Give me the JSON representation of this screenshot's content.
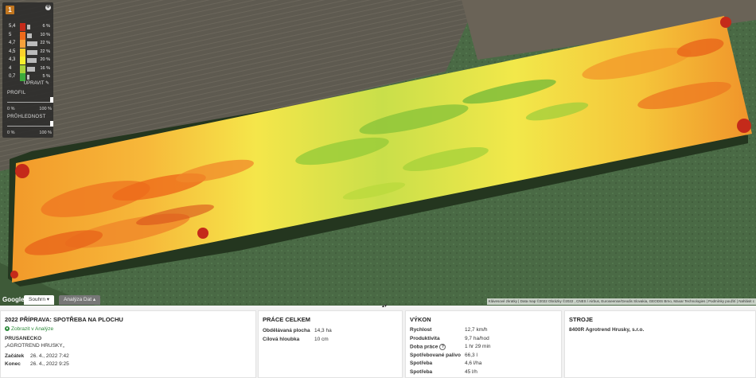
{
  "legend": {
    "badge": "1",
    "rows": [
      {
        "value": "5,4",
        "color": "#c42a1a",
        "pct": "6 %",
        "share": 0.06
      },
      {
        "value": "5",
        "color": "#ee6a1a",
        "pct": "10 %",
        "share": 0.1
      },
      {
        "value": "4,7",
        "color": "#f6a13a",
        "pct": "22 %",
        "share": 0.22
      },
      {
        "value": "4,5",
        "color": "#fbd22a",
        "pct": "22 %",
        "share": 0.22
      },
      {
        "value": "4,3",
        "color": "#f7ef2b",
        "pct": "20 %",
        "share": 0.2
      },
      {
        "value": "4",
        "color": "#a8d23a",
        "pct": "16 %",
        "share": 0.16
      },
      {
        "value": "0,7",
        "color": "#3caa3c",
        "pct": "5 %",
        "share": 0.05
      }
    ],
    "edit_label": "UPRAVIT",
    "profile_label": "PROFIL",
    "transparency_label": "PRŮHLEDNOST",
    "range_min": "0 %",
    "range_max": "100 %"
  },
  "map": {
    "google_label": "Google",
    "tab_summary": "Souhrn",
    "tab_analysis": "Analýza Dat",
    "attribution": "Klávesové zkratky | Data map ©2022 Obrázky ©2022 , CNES / Airbus, Euroseense/Geodis Slovakia, GEODIS Brno, Maxar Technologies | Podmínky použití | Nahlásit c"
  },
  "task": {
    "title": "2022 PŘÍPRAVA: SPOTŘEBA NA PLOCHU",
    "analysis_link": "Zobrazit v Analýze",
    "field_name": "PRUSANECKO",
    "company": "„AGROTREND HRUSKY„",
    "start_label": "Začátek",
    "start_value": "26. 4., 2022 7:42",
    "end_label": "Konec",
    "end_value": "26. 4., 2022 9:25"
  },
  "work": {
    "title": "PRÁCE CELKEM",
    "rows": [
      {
        "label": "Obdělávaná plocha",
        "value": "14,3 ha"
      },
      {
        "label": "Cílová hloubka",
        "value": "10 cm"
      }
    ]
  },
  "performance": {
    "title": "VÝKON",
    "rows": [
      {
        "label": "Rychlost",
        "value": "12,7 km/h"
      },
      {
        "label": "Produktivita",
        "value": "9,7 ha/hod"
      },
      {
        "label": "Doba práce",
        "value": "1 hr 29 min"
      },
      {
        "label": "Spotřebované palivo",
        "value": "66,3 l"
      },
      {
        "label": "Spotřeba",
        "value": "4,6 l/ha"
      },
      {
        "label": "Spotřeba",
        "value": "45 l/h"
      }
    ]
  },
  "machines": {
    "title": "STROJE",
    "machine": "8400R Agrotrend Hrusky, s.r.o."
  }
}
